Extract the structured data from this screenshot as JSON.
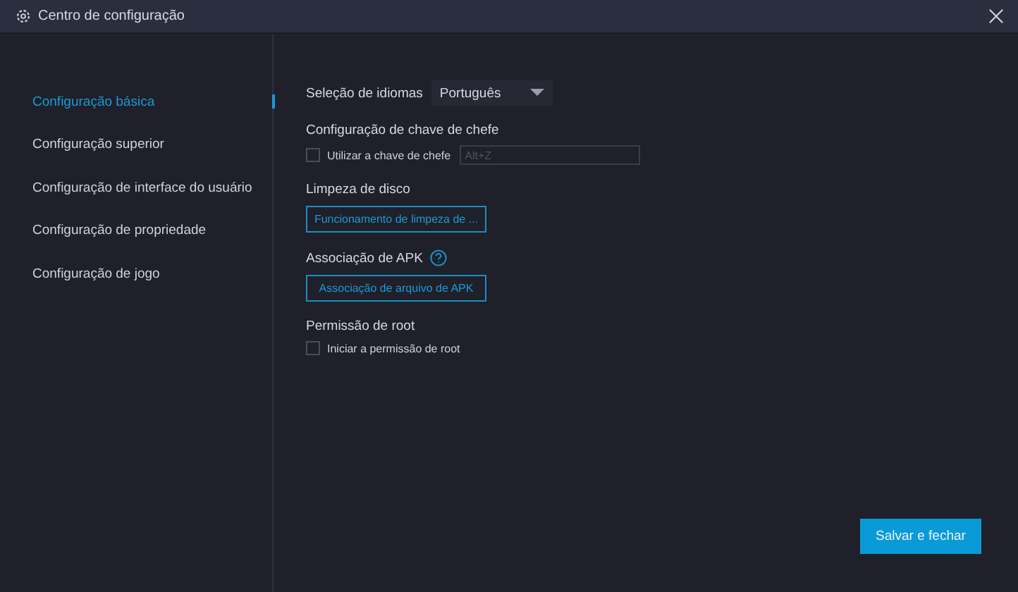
{
  "window": {
    "title": "Centro de configuração"
  },
  "sidebar": {
    "items": [
      {
        "label": "Configuração básica",
        "selected": true
      },
      {
        "label": "Configuração superior",
        "selected": false
      },
      {
        "label": "Configuração de interface do usuário",
        "selected": false
      },
      {
        "label": "Configuração de propriedade",
        "selected": false
      },
      {
        "label": "Configuração de jogo",
        "selected": false
      }
    ]
  },
  "sections": [
    {
      "kind": "select",
      "label": "Seleção de idiomas",
      "value": "Português"
    },
    {
      "kind": "checkbox",
      "title": "Configuração de chave de chefe",
      "option": "Utilizar a chave de chefe",
      "checked": false,
      "placeholder": "Alt+Z"
    },
    {
      "kind": "button",
      "title": "Limpeza de disco",
      "button": "Funcionamento de limpeza de ..."
    },
    {
      "kind": "button",
      "title": "Associação de APK",
      "help": true,
      "button": "Associação de arquivo de APK"
    },
    {
      "kind": "checkbox",
      "title": "Permissão de root",
      "option": "Iniciar a permissão de root",
      "checked": false
    }
  ],
  "footer": {
    "button": "Salvar e fechar"
  }
}
